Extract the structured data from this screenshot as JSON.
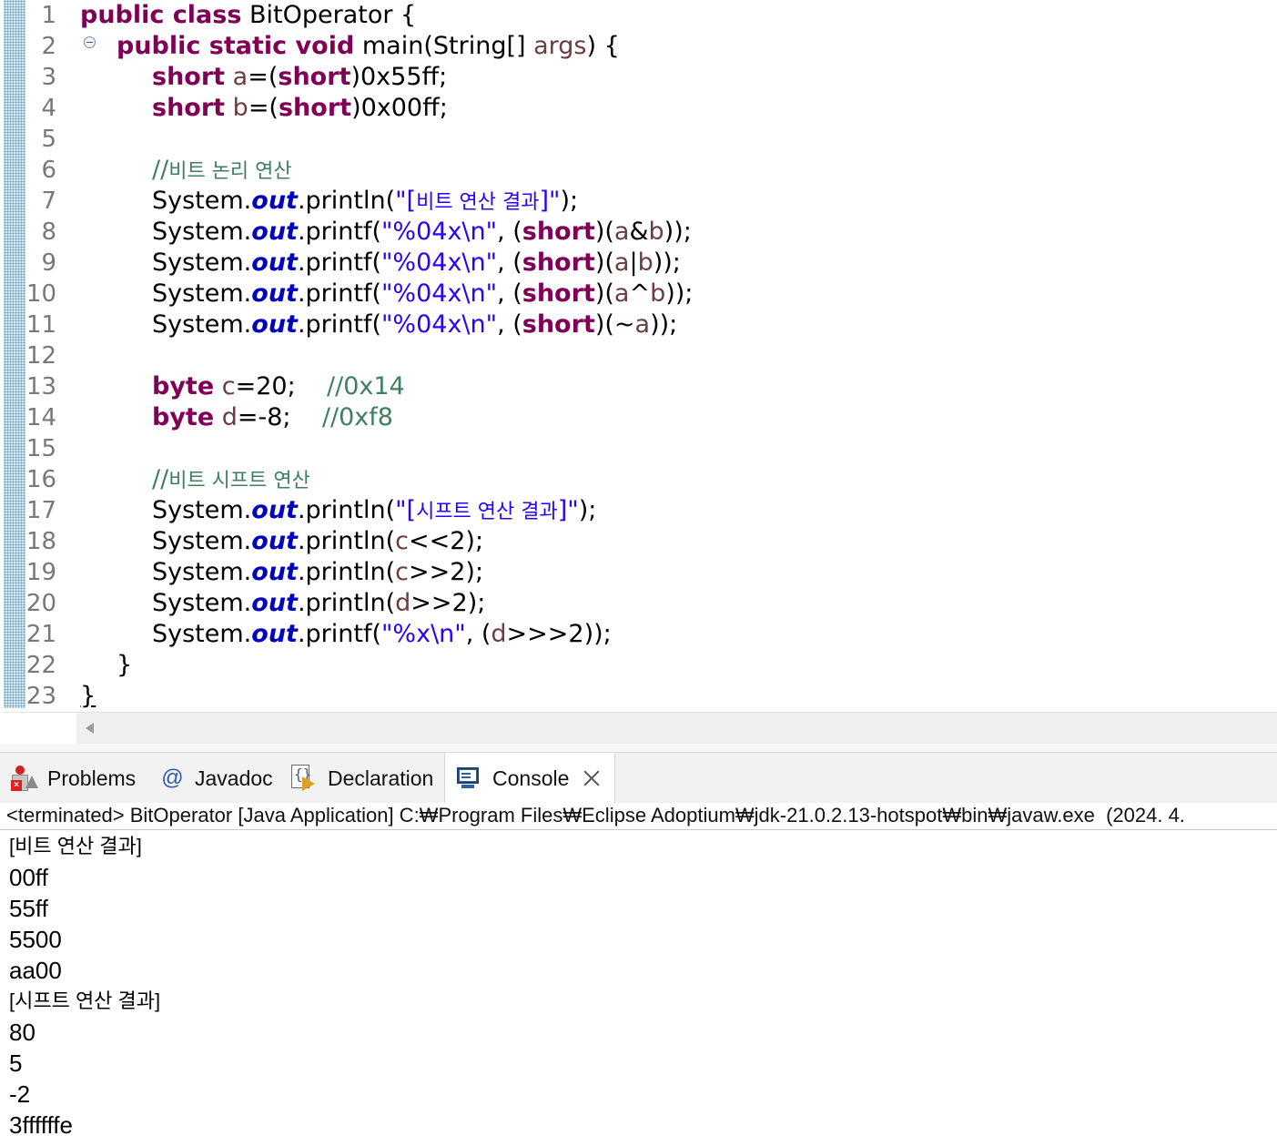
{
  "editor": {
    "line_numbers": [
      "1",
      "2",
      "3",
      "4",
      "5",
      "6",
      "7",
      "8",
      "9",
      "10",
      "11",
      "12",
      "13",
      "14",
      "15",
      "16",
      "17",
      "18",
      "19",
      "20",
      "21",
      "22",
      "23"
    ],
    "code": {
      "l1_kw": "public class",
      "l1_rest": " BitOperator {",
      "l2_kw": "public static void",
      "l2_rest": " main(String[] ",
      "l2_var": "args",
      "l2_end": ") {",
      "l3_kw": "short",
      "l3_var": "a",
      "l3_eq": "=(",
      "l3_kw2": "short",
      "l3_end": ")0x55ff;",
      "l4_kw": "short",
      "l4_var": "b",
      "l4_eq": "=(",
      "l4_kw2": "short",
      "l4_end": ")0x00ff;",
      "l6_cm": "//",
      "l6_cmk": "비트 논리 연산",
      "l7_sys": "System.",
      "l7_out": "out",
      "l7_call": ".println(",
      "l7_str1": "\"[",
      "l7_strk": "비트 연산 결과",
      "l7_str2": "]\"",
      "l7_end": ");",
      "l8_sys": "System.",
      "l8_out": "out",
      "l8_call": ".printf(",
      "l8_str": "\"%04x\\n\"",
      "l8_mid": ", (",
      "l8_kw": "short",
      "l8_p": ")(",
      "l8_v1": "a",
      "l8_op": "&",
      "l8_v2": "b",
      "l8_end": "));",
      "l9_sys": "System.",
      "l9_out": "out",
      "l9_call": ".printf(",
      "l9_str": "\"%04x\\n\"",
      "l9_mid": ", (",
      "l9_kw": "short",
      "l9_p": ")(",
      "l9_v1": "a",
      "l9_op": "|",
      "l9_v2": "b",
      "l9_end": "));",
      "l10_sys": "System.",
      "l10_out": "out",
      "l10_call": ".printf(",
      "l10_str": "\"%04x\\n\"",
      "l10_mid": ", (",
      "l10_kw": "short",
      "l10_p": ")(",
      "l10_v1": "a",
      "l10_op": "^",
      "l10_v2": "b",
      "l10_end": "));",
      "l11_sys": "System.",
      "l11_out": "out",
      "l11_call": ".printf(",
      "l11_str": "\"%04x\\n\"",
      "l11_mid": ", (",
      "l11_kw": "short",
      "l11_p": ")(~",
      "l11_v1": "a",
      "l11_end": "));",
      "l13_kw": "byte",
      "l13_var": "c",
      "l13_eq": "=20;",
      "l13_cm": "//0x14",
      "l14_kw": "byte",
      "l14_var": "d",
      "l14_eq": "=-8;",
      "l14_cm": "//0xf8",
      "l16_cm": "//",
      "l16_cmk": "비트 시프트 연산",
      "l17_sys": "System.",
      "l17_out": "out",
      "l17_call": ".println(",
      "l17_str1": "\"[",
      "l17_strk": "시프트 연산 결과",
      "l17_str2": "]\"",
      "l17_end": ");",
      "l18_sys": "System.",
      "l18_out": "out",
      "l18_call": ".println(",
      "l18_var": "c",
      "l18_end": "<<2);",
      "l19_sys": "System.",
      "l19_out": "out",
      "l19_call": ".println(",
      "l19_var": "c",
      "l19_end": ">>2);",
      "l20_sys": "System.",
      "l20_out": "out",
      "l20_call": ".println(",
      "l20_var": "d",
      "l20_end": ">>2);",
      "l21_sys": "System.",
      "l21_out": "out",
      "l21_call": ".printf(",
      "l21_str": "\"%x\\n\"",
      "l21_mid": ", (",
      "l21_var": "d",
      "l21_end": ">>>2));",
      "l22": "}",
      "l23": "}"
    }
  },
  "panel": {
    "tabs": [
      {
        "label": "Problems"
      },
      {
        "label": "Javadoc"
      },
      {
        "label": "Declaration"
      },
      {
        "label": "Console"
      }
    ],
    "javadoc_glyph": "@",
    "declaration_glyph": "{}",
    "console_status": "<terminated> BitOperator [Java Application] C:₩Program Files₩Eclipse Adoptium₩jdk-21.0.2.13-hotspot₩bin₩javaw.exe  (2024. 4.",
    "output": [
      "[비트 연산 결과]",
      "00ff",
      "55ff",
      "5500",
      "aa00",
      "[시프트 연산 결과]",
      "80",
      "5",
      "-2",
      "3ffffffe"
    ]
  },
  "colors": {
    "keyword": "#7f0055",
    "field": "#0000c0",
    "string": "#2a00ff",
    "comment": "#3f7f5f",
    "variable": "#6a3e3e"
  },
  "icons": [
    "problems-icon",
    "javadoc-icon",
    "declaration-icon",
    "console-icon",
    "close-icon",
    "fold-collapse-icon",
    "scroll-left-arrow-icon"
  ]
}
